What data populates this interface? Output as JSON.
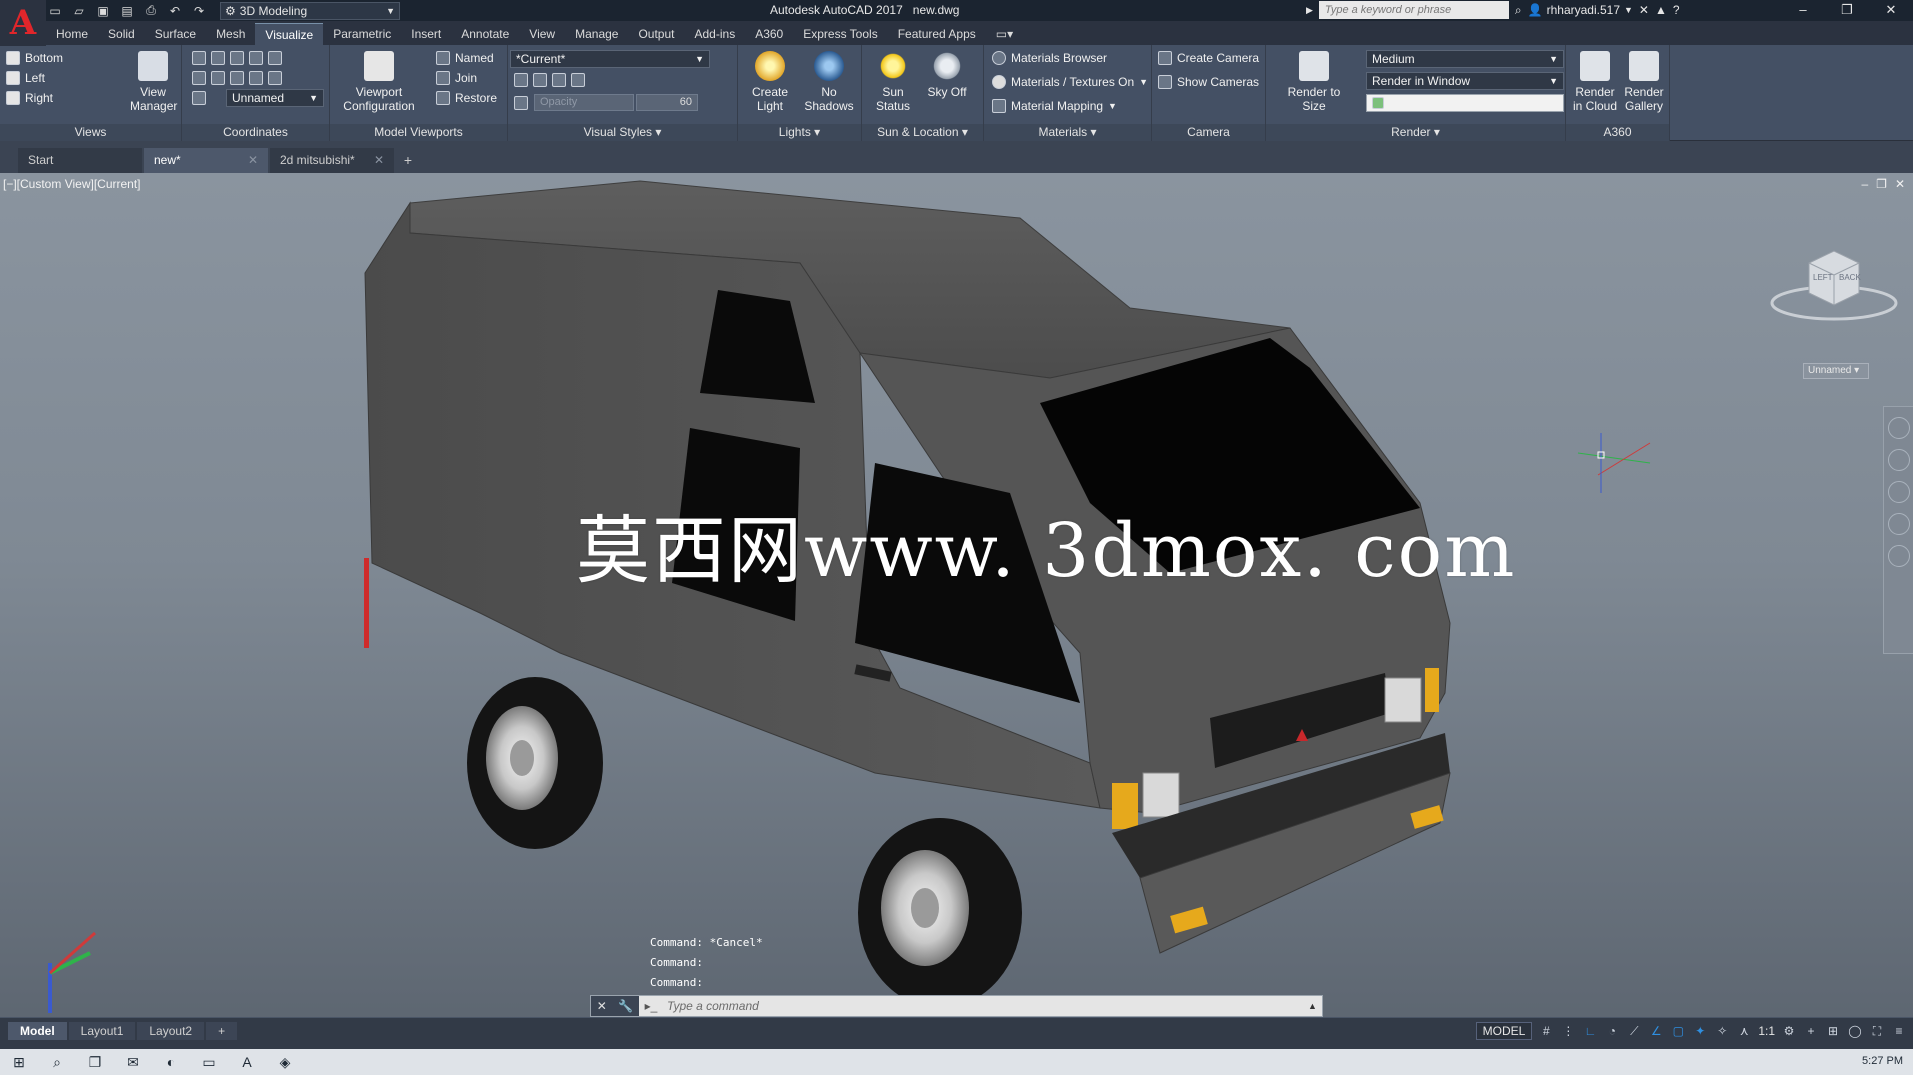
{
  "titlebar": {
    "workspace": "3D Modeling",
    "app_title": "Autodesk AutoCAD 2017",
    "file_name": "new.dwg",
    "search_placeholder": "Type a keyword or phrase",
    "user": "rhharyadi.517"
  },
  "tabs": [
    "Home",
    "Solid",
    "Surface",
    "Mesh",
    "Visualize",
    "Parametric",
    "Insert",
    "Annotate",
    "View",
    "Manage",
    "Output",
    "Add-ins",
    "A360",
    "Express Tools",
    "Featured Apps"
  ],
  "active_tab": "Visualize",
  "ribbon": {
    "views": {
      "items": [
        "Bottom",
        "Left",
        "Right"
      ],
      "view_manager": "View Manager",
      "title": "Views"
    },
    "coordinates": {
      "ucs_name": "Unnamed",
      "title": "Coordinates"
    },
    "model_viewports": {
      "named": "Named",
      "join": "Join",
      "restore": "Restore",
      "config": "Viewport Configuration",
      "title": "Model Viewports"
    },
    "visual_styles": {
      "current": "*Current*",
      "opacity_label": "Opacity",
      "opacity_value": "60",
      "title": "Visual Styles"
    },
    "lights": {
      "create_light": "Create Light",
      "no_shadows": "No Shadows",
      "title": "Lights"
    },
    "sun": {
      "sun_status": "Sun Status",
      "sky_off": "Sky Off",
      "title": "Sun & Location"
    },
    "materials": {
      "browser": "Materials Browser",
      "textures": "Materials / Textures On",
      "mapping": "Material Mapping",
      "title": "Materials"
    },
    "camera": {
      "create": "Create Camera",
      "show": "Show  Cameras",
      "title": "Camera"
    },
    "render": {
      "render_to_size": "Render to Size",
      "quality": "Medium",
      "output": "Render in Window",
      "title": "Render"
    },
    "a360": {
      "cloud": "Render in Cloud",
      "gallery": "Render Gallery",
      "title": "A360"
    }
  },
  "file_tabs": [
    {
      "label": "Start"
    },
    {
      "label": "new*"
    },
    {
      "label": "2d mitsubishi*"
    }
  ],
  "viewport": {
    "label": "[−][Custom View][Current]",
    "watermark": "莫西网www. 3dmox. com",
    "unnamed": "Unnamed",
    "cube_faces": [
      "LEFT",
      "BACK"
    ]
  },
  "command": {
    "history": [
      "Command: *Cancel*",
      "Command:",
      "Command:"
    ],
    "placeholder": "Type a command"
  },
  "layout_tabs": [
    "Model",
    "Layout1",
    "Layout2"
  ],
  "status": {
    "model": "MODEL",
    "scale": "1:1"
  },
  "taskbar": {
    "time": "5:27 PM"
  },
  "colors": {
    "ribbon": "#445064",
    "accent": "#e0262b",
    "viewport_top": "#8a949f"
  }
}
